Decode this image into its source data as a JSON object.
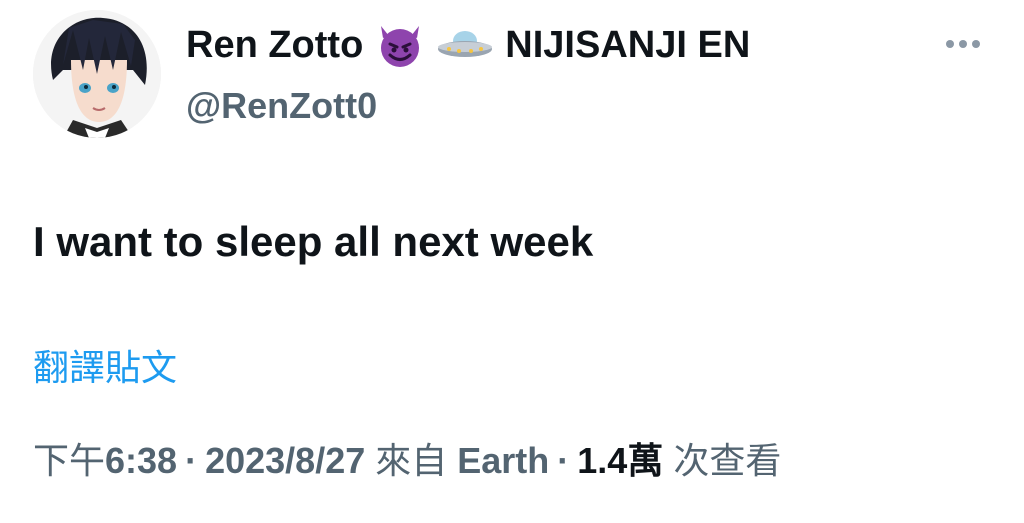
{
  "author": {
    "display_name": "Ren Zotto",
    "emoji_1": "smiling-devil-emoji",
    "emoji_2": "ufo-emoji",
    "affiliation": "NIJISANJI EN",
    "handle": "@RenZott0",
    "avatar_icon": "anime-avatar"
  },
  "more_icon": "more-dots-icon",
  "tweet": {
    "text": "I want to sleep all next week"
  },
  "translate_label": "翻譯貼文",
  "meta": {
    "time_prefix": "下午",
    "time": "6:38",
    "date": "2023/8/27",
    "from_label": "來自",
    "source": "Earth",
    "views_count": "1.4萬",
    "views_label": "次查看"
  },
  "colors": {
    "text": "#0f1419",
    "secondary": "#536471",
    "link": "#1d9bf0",
    "devil_purple": "#8e44ad"
  }
}
